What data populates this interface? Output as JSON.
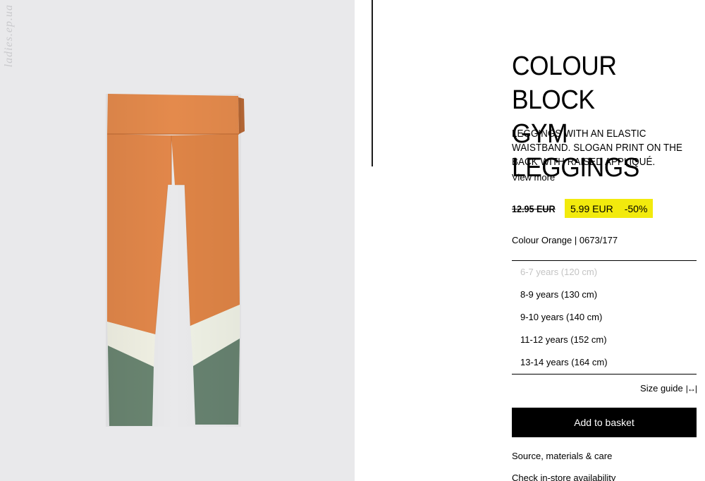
{
  "product": {
    "watermark": "ladies.ep.ua",
    "title": "COLOUR BLOCK\nGYM LEGGINGS",
    "description": "LEGGINGS WITH AN ELASTIC WAISTBAND. SLOGAN PRINT ON THE BACK WITH RAISED APPLIQUÉ. COLOUR",
    "view_more": "View more",
    "old_price": "12.95 EUR",
    "price": "5.99 EUR",
    "discount": "-50%",
    "colour_line": "Colour Orange | 0673/177",
    "colors": {
      "orange": "#e2874a",
      "white_band": "#f1f1e4",
      "green": "#6a8571",
      "price_highlight": "#f2ea0d"
    }
  },
  "sizes": [
    {
      "label": "6-7 years (120 cm)",
      "available": false
    },
    {
      "label": "8-9 years (130 cm)",
      "available": true
    },
    {
      "label": "9-10 years (140 cm)",
      "available": true
    },
    {
      "label": "11-12 years (152 cm)",
      "available": true
    },
    {
      "label": "13-14 years (164 cm)",
      "available": true
    }
  ],
  "size_guide": {
    "label": "Size guide",
    "icon": "resize-arrows-icon",
    "glyph": "|↔|"
  },
  "actions": {
    "add_to_basket": "Add to basket",
    "source_materials": "Source, materials & care",
    "check_store": "Check in-store availability"
  }
}
